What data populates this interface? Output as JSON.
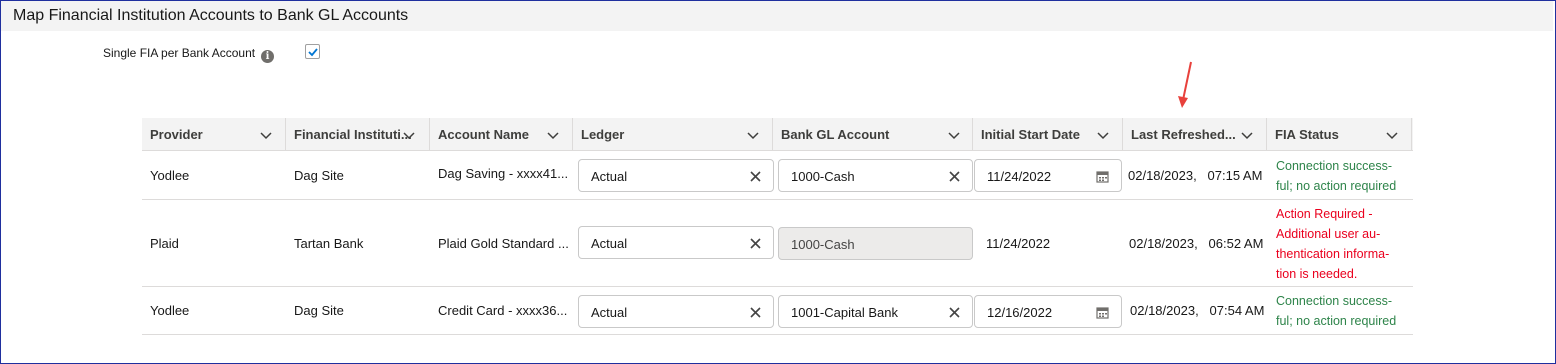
{
  "page": {
    "title": "Map Financial Institution Accounts to Bank GL Accounts",
    "option_label": "Single FIA per Bank Account",
    "option_checked": true
  },
  "columns": [
    {
      "label": "Provider"
    },
    {
      "label": "Financial Instituti..."
    },
    {
      "label": "Account Name"
    },
    {
      "label": "Ledger"
    },
    {
      "label": "Bank GL Account"
    },
    {
      "label": "Initial Start Date"
    },
    {
      "label": "Last Refreshed..."
    },
    {
      "label": "FIA Status"
    }
  ],
  "rows": [
    {
      "provider": "Yodlee",
      "institution": "Dag Site",
      "account_name": "Dag Saving - xxxx41...",
      "ledger": "Actual",
      "bank_gl": "1000-Cash",
      "start_date": "11/24/2022",
      "last_refreshed": "02/18/2023,   07:15 AM",
      "status_lines": [
        "Connection success-",
        "ful; no action required"
      ],
      "status_color": "#2e844a"
    },
    {
      "provider": "Plaid",
      "institution": "Tartan Bank",
      "account_name": "Plaid Gold Standard ...",
      "ledger": "Actual",
      "bank_gl": "1000-Cash",
      "start_date": "11/24/2022",
      "last_refreshed": "02/18/2023,   06:52 AM",
      "status_lines": [
        "Action Required -",
        "Additional user au-",
        "thentication informa-",
        "tion is needed."
      ],
      "status_color": "#ea001e"
    },
    {
      "provider": "Yodlee",
      "institution": "Dag Site",
      "account_name": "Credit Card - xxxx36...",
      "ledger": "Actual",
      "bank_gl": "1001-Capital Bank",
      "start_date": "12/16/2022",
      "last_refreshed": "02/18/2023,   07:54 AM",
      "status_lines": [
        "Connection success-",
        "ful; no action required"
      ],
      "status_color": "#2e844a"
    }
  ],
  "icons": {
    "info": "info-icon",
    "checkbox": "checkmark-icon",
    "column_menu": "chevron-down-icon",
    "clear": "close-icon",
    "date_picker": "calendar-icon",
    "annotation": "red-arrow-annotation"
  },
  "colors": {
    "success": "#2e844a",
    "error": "#ea001e",
    "annotation_arrow": "#e8413c",
    "checkbox_check": "#0176d3"
  }
}
